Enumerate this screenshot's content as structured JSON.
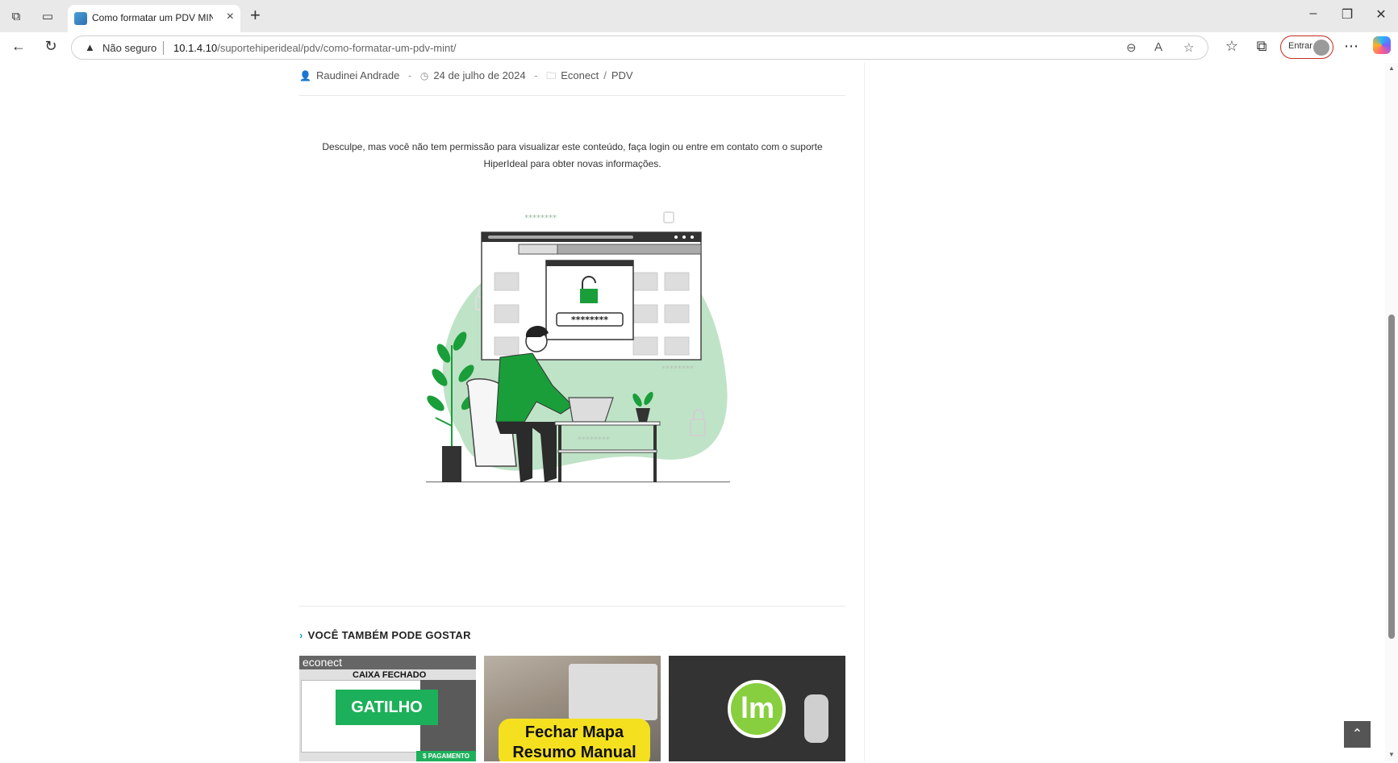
{
  "browser": {
    "tab_title": "Como formatar um PDV MINT – S",
    "address": {
      "security_label": "Não seguro",
      "host": "10.1.4.10",
      "path": "/suportehiperideal/pdv/como-formatar-um-pdv-mint/"
    },
    "signin_label": "Entrar"
  },
  "post": {
    "author": "Raudinei Andrade",
    "date": "24 de julho de 2024",
    "categories": [
      "Econect",
      "PDV"
    ],
    "category_separator": "/",
    "notice": "Desculpe, mas você não tem permissão para visualizar este conteúdo, faça login ou entre em contato com o suporte HiperIdeal para obter novas informações."
  },
  "illustration": {
    "password_mask": "********",
    "accent_color": "#1a9e3a",
    "blob_color": "#bfe3c7"
  },
  "related": {
    "heading": "VOCÊ TAMBÉM PODE GOSTAR",
    "cards": [
      {
        "logo": "econect",
        "caption": "CAIXA FECHADO",
        "title": "GATILHO",
        "badge": "$ PAGAMENTO"
      },
      {
        "title": "Fechar Mapa Resumo Manual"
      },
      {
        "logo": "lm"
      }
    ]
  }
}
